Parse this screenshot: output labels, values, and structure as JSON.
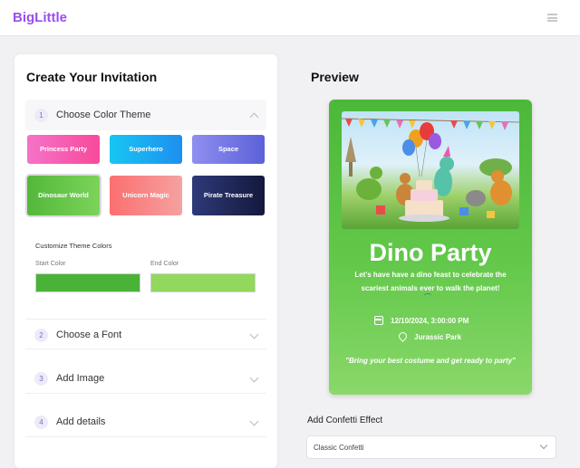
{
  "app": {
    "logo": "BigLittle"
  },
  "builder": {
    "title": "Create Your Invitation",
    "steps": [
      {
        "number": "1",
        "label": "Choose Color Theme",
        "expanded": true
      },
      {
        "number": "2",
        "label": "Choose a Font",
        "expanded": false
      },
      {
        "number": "3",
        "label": "Add Image",
        "expanded": false
      },
      {
        "number": "4",
        "label": "Add details",
        "expanded": false
      }
    ],
    "themes": [
      {
        "label": "Princess Party",
        "gradient": [
          "#f572c8",
          "#f84a9c"
        ]
      },
      {
        "label": "Superhero",
        "gradient": [
          "#18c6f3",
          "#1e8ff0"
        ]
      },
      {
        "label": "Space",
        "gradient": [
          "#8f8ff0",
          "#5b61d8"
        ]
      },
      {
        "label": "Dinosaur World",
        "gradient": [
          "#52b83b",
          "#7dd35a"
        ],
        "selected": true
      },
      {
        "label": "Unicorn Magic",
        "gradient": [
          "#fb6f6f",
          "#f6a1a1"
        ]
      },
      {
        "label": "Pirate Treasure",
        "gradient": [
          "#2e3a78",
          "#15183d"
        ]
      }
    ],
    "customize": {
      "title": "Customize Theme Colors",
      "start_label": "Start Color",
      "end_label": "End Color",
      "start_color": "#4ab337",
      "end_color": "#92d85c"
    }
  },
  "preview": {
    "title": "Preview",
    "card": {
      "title": "Dino Party",
      "description": "Let's have have a dino feast to celebrate the scariest animals ever to walk the planet!",
      "datetime": "12/10/2024, 3:00:00 PM",
      "location": "Jurassic Park",
      "quote": "\"Bring your best costume and get ready to party\"",
      "icons": [
        "calendar-icon",
        "map-pin-icon"
      ]
    }
  },
  "confetti": {
    "label": "Add Confetti Effect",
    "selected": "Classic Confetti"
  }
}
